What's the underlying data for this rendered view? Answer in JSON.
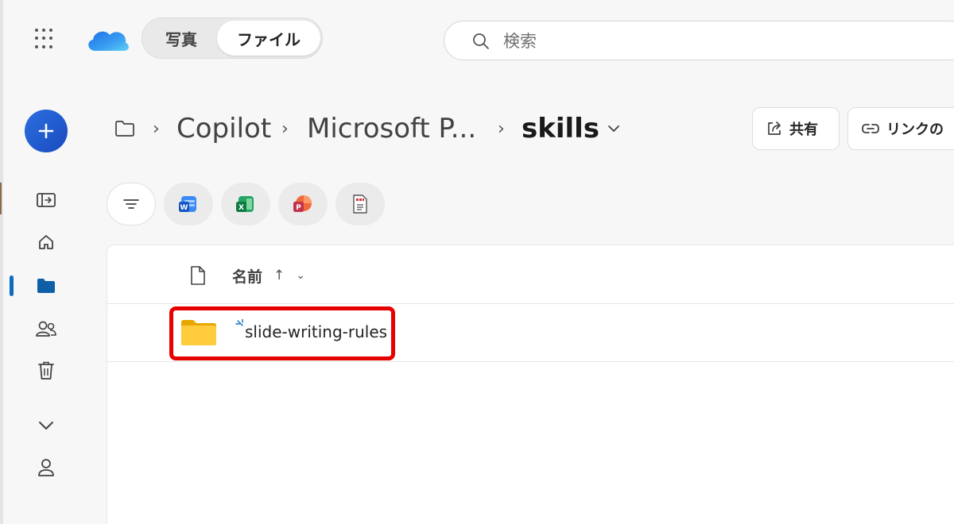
{
  "header": {
    "segment": {
      "photos_label": "写真",
      "files_label": "ファイル",
      "selected": "files"
    },
    "search": {
      "placeholder": "検索"
    },
    "icons": {
      "apps": "waffle-icon",
      "logo": "onedrive-cloud-logo"
    }
  },
  "left_rail": {
    "add_button": "plus-icon",
    "items": [
      {
        "id": "side-panel",
        "icon": "panel-toggle-icon"
      },
      {
        "id": "home",
        "icon": "home-icon"
      },
      {
        "id": "my-files",
        "icon": "folder-icon",
        "active": true
      },
      {
        "id": "shared",
        "icon": "people-icon"
      },
      {
        "id": "recycle-bin",
        "icon": "trash-icon"
      },
      {
        "id": "more",
        "icon": "chevron-down-icon"
      },
      {
        "id": "account",
        "icon": "person-icon"
      }
    ]
  },
  "breadcrumb": {
    "items": [
      "Copilot",
      "Microsoft P..."
    ],
    "current": "skills"
  },
  "actions": {
    "share_label": "共有",
    "copy_link_label": "リンクの"
  },
  "filters": [
    "filter-icon",
    "word-icon",
    "excel-icon",
    "powerpoint-icon",
    "pdf-icon"
  ],
  "table": {
    "column_name": "名前",
    "sort_indicator": "↑",
    "rows": [
      {
        "name": "slide-writing-rules",
        "type": "folder",
        "status": "new"
      }
    ]
  },
  "colors": {
    "accent": "#0f6cbd",
    "add_button": "#2b6fe0",
    "folder": "#f5c518",
    "highlight": "#e60000"
  }
}
